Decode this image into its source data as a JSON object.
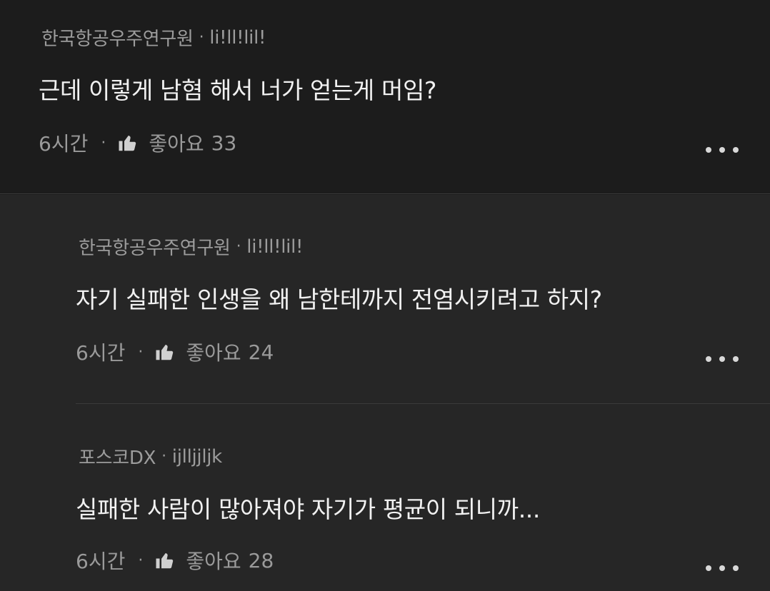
{
  "comments": [
    {
      "author": "한국항공우주연구원",
      "separator": "·",
      "user_id": "li!ll!lil!",
      "body": "근데 이렇게 남혐 해서 너가 얻는게 머임?",
      "time": "6시간",
      "meta_separator": "·",
      "like_label": "좋아요",
      "like_count": "33",
      "icon": "thumbs-up-icon"
    },
    {
      "author": "한국항공우주연구원",
      "separator": "·",
      "user_id": "li!ll!lil!",
      "body": "자기 실패한 인생을 왜 남한테까지 전염시키려고 하지?",
      "time": "6시간",
      "meta_separator": "·",
      "like_label": "좋아요",
      "like_count": "24",
      "icon": "thumbs-up-icon"
    },
    {
      "author": "포스코DX",
      "separator": "·",
      "user_id": "ijlljjljk",
      "body": "실패한 사람이 많아져야 자기가 평균이 되니까...",
      "time": "6시간",
      "meta_separator": "·",
      "like_label": "좋아요",
      "like_count": "28",
      "icon": "thumbs-up-icon"
    }
  ],
  "colors": {
    "background": "#1c1c1c",
    "reply_background": "#262626",
    "body_text": "#f1f1f1",
    "secondary_text": "#9c9c9c"
  }
}
